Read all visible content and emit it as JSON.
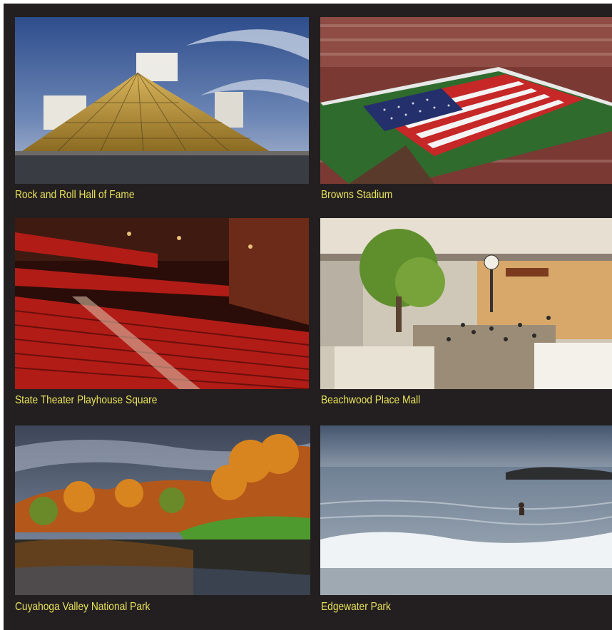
{
  "places": [
    {
      "caption": "Rock and Roll Hall of Fame",
      "image": "glass-pyramid-building-at-dusk"
    },
    {
      "caption": "Browns Stadium",
      "image": "stadium-with-giant-american-flag"
    },
    {
      "caption": "State Theater Playhouse Square",
      "image": "red-seated-theater-interior"
    },
    {
      "caption": "Beachwood Place Mall",
      "image": "shopping-mall-atrium"
    },
    {
      "caption": "Cuyahoga Valley National Park",
      "image": "autumn-trees-reflected-in-pond"
    },
    {
      "caption": "Edgewater Park",
      "image": "lake-waves-with-swimmer"
    }
  ],
  "colors": {
    "background": "#231f20",
    "caption": "#e8e35a"
  }
}
